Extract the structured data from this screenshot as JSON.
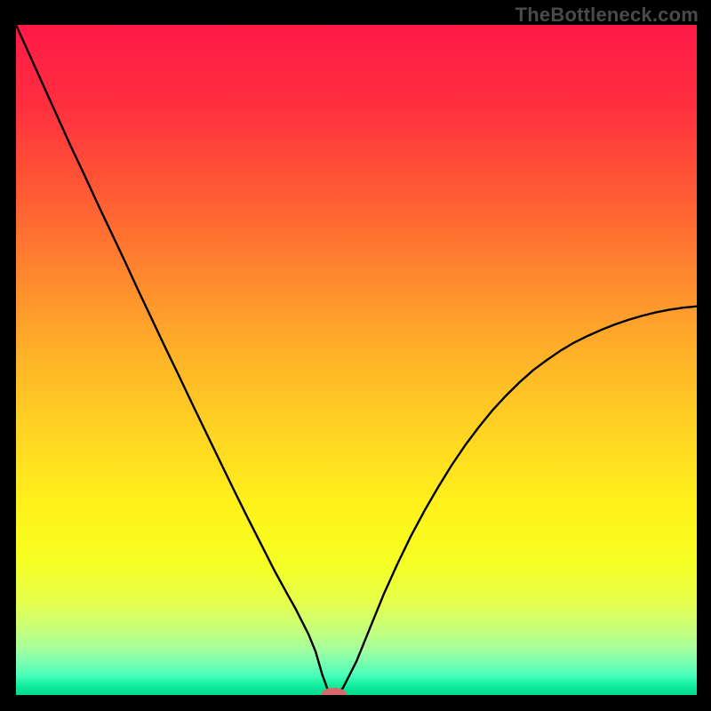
{
  "watermark": "TheBottleneck.com",
  "chart_data": {
    "type": "line",
    "title": "",
    "xlabel": "",
    "ylabel": "",
    "xlim": [
      0,
      100
    ],
    "ylim": [
      0,
      100
    ],
    "grid": false,
    "x": [
      0,
      2,
      4,
      6,
      8,
      10,
      12,
      14,
      16,
      18,
      20,
      22,
      24,
      26,
      28,
      30,
      32,
      34,
      36,
      38,
      40,
      41,
      42,
      43,
      44,
      45,
      46,
      47,
      48,
      50,
      52,
      54,
      56,
      58,
      60,
      62,
      64,
      66,
      68,
      70,
      72,
      74,
      76,
      78,
      80,
      82,
      84,
      86,
      88,
      90,
      92,
      94,
      96,
      98,
      100
    ],
    "values": [
      100,
      95.5,
      91,
      86.5,
      82,
      77.7,
      73.3,
      69,
      64.7,
      60.3,
      56,
      51.7,
      47.5,
      43.2,
      39,
      34.8,
      30.6,
      26.5,
      22.5,
      18.5,
      14.8,
      13,
      11,
      9,
      6.5,
      3,
      0.2,
      0.2,
      1,
      5,
      10,
      15,
      19.5,
      23.7,
      27.5,
      31,
      34.3,
      37.3,
      40,
      42.5,
      44.7,
      46.7,
      48.5,
      50,
      51.4,
      52.6,
      53.6,
      54.5,
      55.3,
      56,
      56.6,
      57.1,
      57.5,
      57.8,
      58
    ],
    "background_gradient_stops": [
      {
        "offset": 0.0,
        "color": "#ff1948"
      },
      {
        "offset": 0.12,
        "color": "#ff2f3e"
      },
      {
        "offset": 0.25,
        "color": "#ff5a34"
      },
      {
        "offset": 0.38,
        "color": "#ff8a2e"
      },
      {
        "offset": 0.5,
        "color": "#ffb528"
      },
      {
        "offset": 0.62,
        "color": "#ffd722"
      },
      {
        "offset": 0.72,
        "color": "#fff21a"
      },
      {
        "offset": 0.8,
        "color": "#f7ff22"
      },
      {
        "offset": 0.86,
        "color": "#e6ff4a"
      },
      {
        "offset": 0.9,
        "color": "#c8ff78"
      },
      {
        "offset": 0.93,
        "color": "#a6ff9c"
      },
      {
        "offset": 0.95,
        "color": "#7dffb0"
      },
      {
        "offset": 0.97,
        "color": "#4affb8"
      },
      {
        "offset": 0.985,
        "color": "#14efa0"
      },
      {
        "offset": 1.0,
        "color": "#00d88a"
      }
    ],
    "marker": {
      "x": 46.7,
      "y": 0.2,
      "rx": 1.8,
      "ry": 0.9,
      "color": "#d46a6a"
    },
    "line_color": "#000000",
    "line_width": 2.4
  }
}
